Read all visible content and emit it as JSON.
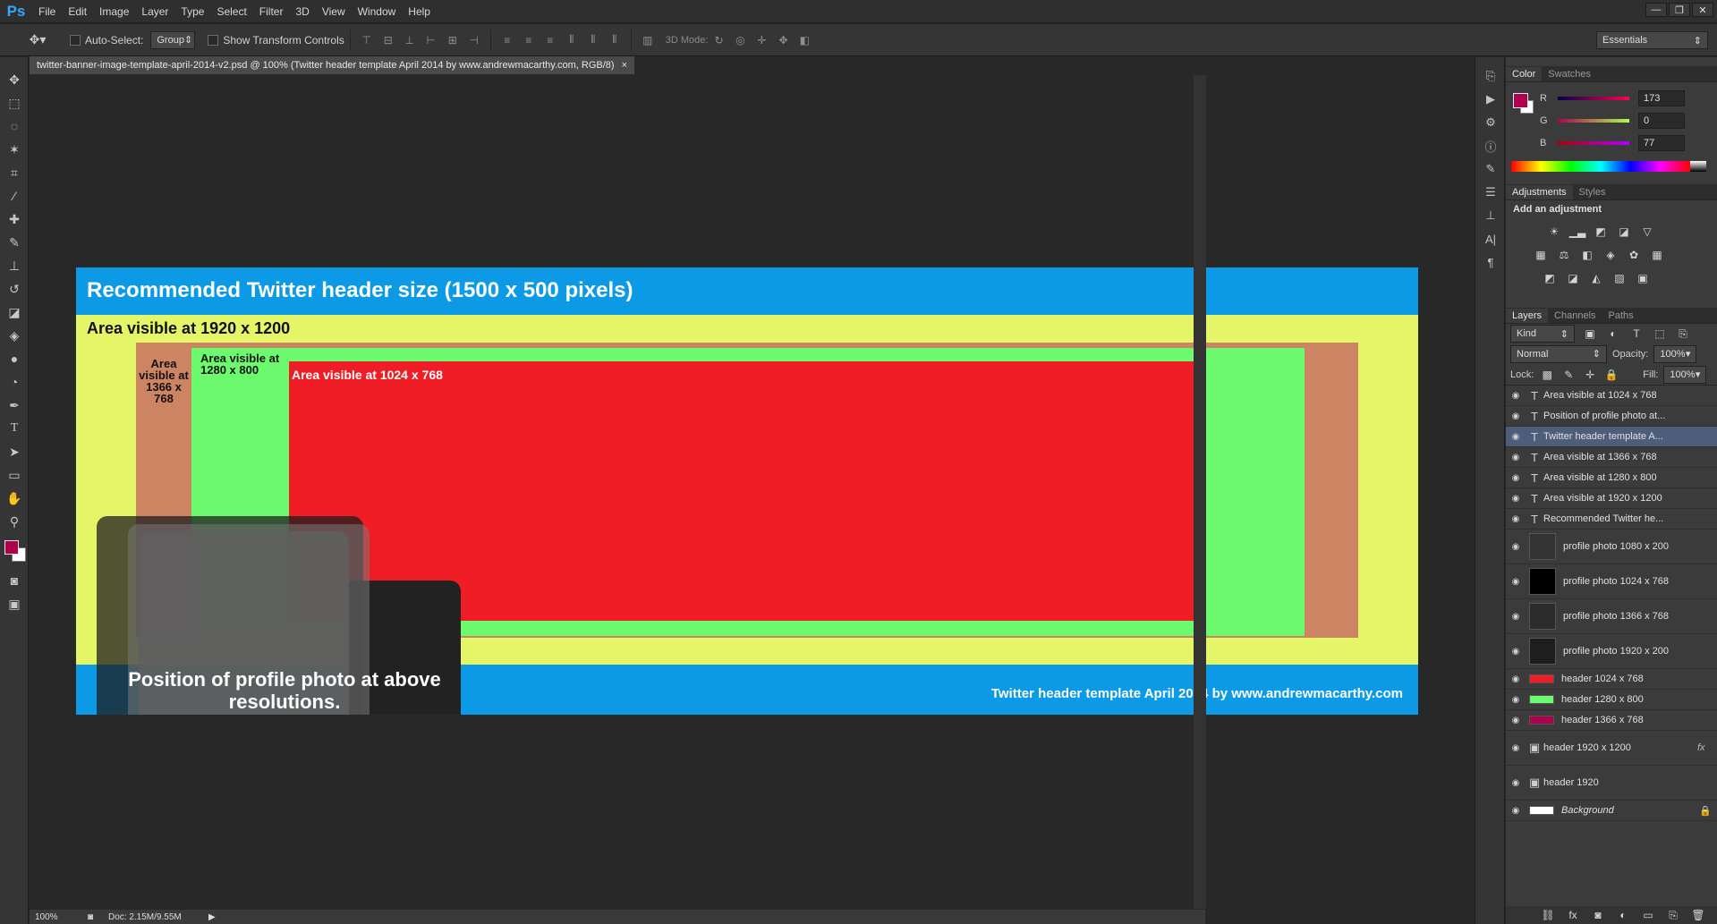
{
  "app": {
    "logo": "Ps",
    "menu": [
      "File",
      "Edit",
      "Image",
      "Layer",
      "Type",
      "Select",
      "Filter",
      "3D",
      "View",
      "Window",
      "Help"
    ],
    "window_controls": [
      "—",
      "❐",
      "✕"
    ]
  },
  "options_bar": {
    "auto_select_label": "Auto-Select:",
    "auto_select_value": "Group",
    "show_transform_label": "Show Transform Controls",
    "mode3d_label": "3D Mode:",
    "workspace": "Essentials"
  },
  "document": {
    "tab_title": "twitter-banner-image-template-april-2014-v2.psd @ 100% (Twitter header template April 2014 by www.andrewmacarthy.com, RGB/8)",
    "zoom": "100%",
    "doc_info": "Doc: 2.15M/9.55M"
  },
  "banner": {
    "title": "Recommended Twitter header size (1500 x 500 pixels)",
    "label_1920": "Area visible at 1920 x 1200",
    "label_1366": "Area visible at 1366 x 768",
    "label_1280": "Area visible at 1280 x 800",
    "label_1024": "Area visible at 1024 x 768",
    "profile_text": "Position of profile photo at above resolutions.",
    "credit": "Twitter header template April 2014 by www.andrewmacarthy.com",
    "colors": {
      "blue": "#0c9ae6",
      "yellow": "#e5f568",
      "tan": "#cd8463",
      "green": "#6cfb6f",
      "red": "#ee1d26"
    }
  },
  "color_panel": {
    "tabs": [
      "Color",
      "Swatches"
    ],
    "r_label": "R",
    "g_label": "G",
    "b_label": "B",
    "r": "173",
    "g": "0",
    "b": "77",
    "fg_color": "#ad004d"
  },
  "adjustments_panel": {
    "tabs": [
      "Adjustments",
      "Styles"
    ],
    "heading": "Add an adjustment"
  },
  "layers_panel": {
    "tabs": [
      "Layers",
      "Channels",
      "Paths"
    ],
    "filter_kind": "Kind",
    "blend_mode": "Normal",
    "opacity_label": "Opacity:",
    "opacity": "100%",
    "lock_label": "Lock:",
    "fill_label": "Fill:",
    "fill": "100%",
    "layers": [
      {
        "name": "Area visible at 1024 x 768",
        "type": "text"
      },
      {
        "name": "Position of profile photo at...",
        "type": "text"
      },
      {
        "name": "Twitter header template A...",
        "type": "text",
        "selected": true
      },
      {
        "name": "Area  visible  at 1366  x 768",
        "type": "text"
      },
      {
        "name": "Area visible at  1280 x 800",
        "type": "text"
      },
      {
        "name": "Area visible at 1920 x 1200",
        "type": "text"
      },
      {
        "name": "Recommended Twitter he...",
        "type": "text"
      },
      {
        "name": "profile photo 1080 x 200",
        "type": "smart"
      },
      {
        "name": "profile photo 1024 x 768",
        "type": "smart"
      },
      {
        "name": "profile photo 1366 x 768",
        "type": "smart"
      },
      {
        "name": "profile photo 1920 x 200",
        "type": "smart"
      },
      {
        "name": "header 1024 x 768",
        "type": "fill",
        "color": "#ee1d26"
      },
      {
        "name": "header 1280 x 800",
        "type": "fill",
        "color": "#6cfb6f"
      },
      {
        "name": "header 1366 x 768",
        "type": "fill",
        "color": "#ad004d"
      },
      {
        "name": "header 1920 x 1200",
        "type": "fx"
      },
      {
        "name": "header 1920",
        "type": "shape"
      },
      {
        "name": "Background",
        "type": "background"
      }
    ]
  }
}
